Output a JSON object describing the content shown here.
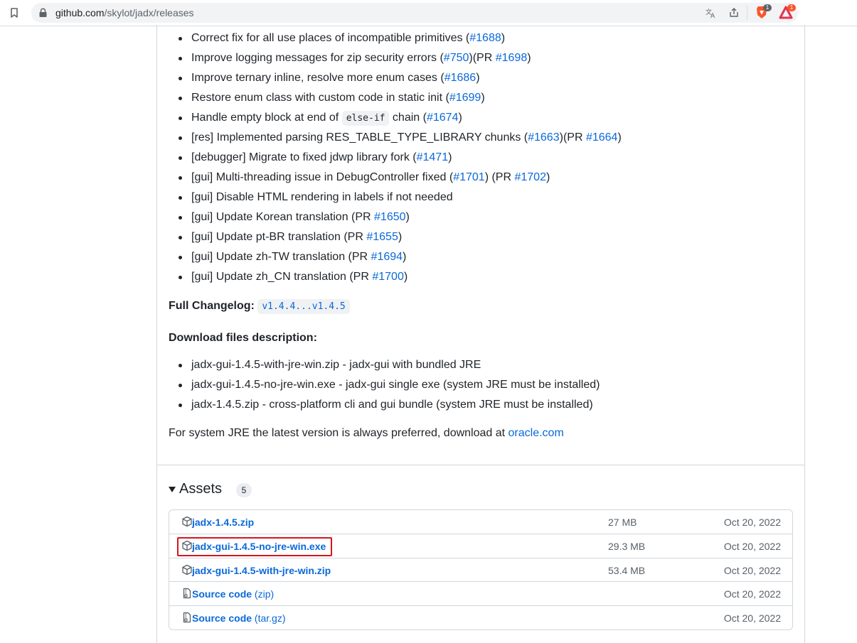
{
  "browser": {
    "url_host": "github.com",
    "url_path": "/skylot/jadx/releases",
    "extensions": [
      {
        "name": "brave-shields",
        "badge": "1",
        "color": "#fb542b"
      },
      {
        "name": "brave-rewards",
        "badge": "1",
        "color": "#fb542b"
      }
    ]
  },
  "notes": [
    {
      "parts": [
        {
          "t": "Correct fix for all use places of incompatible primitives ("
        },
        {
          "l": "#1688"
        },
        {
          "t": ")"
        }
      ]
    },
    {
      "parts": [
        {
          "t": "Improve logging messages for zip security errors ("
        },
        {
          "l": "#750"
        },
        {
          "t": ")(PR "
        },
        {
          "l": "#1698"
        },
        {
          "t": ")"
        }
      ]
    },
    {
      "parts": [
        {
          "t": "Improve ternary inline, resolve more enum cases ("
        },
        {
          "l": "#1686"
        },
        {
          "t": ")"
        }
      ]
    },
    {
      "parts": [
        {
          "t": "Restore enum class with custom code in static init ("
        },
        {
          "l": "#1699"
        },
        {
          "t": ")"
        }
      ]
    },
    {
      "parts": [
        {
          "t": "Handle empty block at end of "
        },
        {
          "c": "else-if"
        },
        {
          "t": " chain ("
        },
        {
          "l": "#1674"
        },
        {
          "t": ")"
        }
      ]
    },
    {
      "parts": [
        {
          "t": "[res] Implemented parsing RES_TABLE_TYPE_LIBRARY chunks ("
        },
        {
          "l": "#1663"
        },
        {
          "t": ")(PR "
        },
        {
          "l": "#1664"
        },
        {
          "t": ")"
        }
      ]
    },
    {
      "parts": [
        {
          "t": "[debugger] Migrate to fixed jdwp library fork ("
        },
        {
          "l": "#1471"
        },
        {
          "t": ")"
        }
      ]
    },
    {
      "parts": [
        {
          "t": "[gui] Multi-threading issue in DebugController fixed ("
        },
        {
          "l": "#1701"
        },
        {
          "t": ") (PR "
        },
        {
          "l": "#1702"
        },
        {
          "t": ")"
        }
      ]
    },
    {
      "parts": [
        {
          "t": "[gui] Disable HTML rendering in labels if not needed"
        }
      ]
    },
    {
      "parts": [
        {
          "t": "[gui] Update Korean translation (PR "
        },
        {
          "l": "#1650"
        },
        {
          "t": ")"
        }
      ]
    },
    {
      "parts": [
        {
          "t": "[gui] Update pt-BR translation (PR "
        },
        {
          "l": "#1655"
        },
        {
          "t": ")"
        }
      ]
    },
    {
      "parts": [
        {
          "t": "[gui] Update zh-TW translation (PR "
        },
        {
          "l": "#1694"
        },
        {
          "t": ")"
        }
      ]
    },
    {
      "parts": [
        {
          "t": "[gui] Update zh_CN translation (PR "
        },
        {
          "l": "#1700"
        },
        {
          "t": ")"
        }
      ]
    }
  ],
  "changelog": {
    "label": "Full Changelog",
    "colon": ":",
    "ref": "v1.4.4...v1.4.5"
  },
  "download_heading": "Download files description:",
  "downloads": [
    "jadx-gui-1.4.5-with-jre-win.zip - jadx-gui with bundled JRE",
    "jadx-gui-1.4.5-no-jre-win.exe - jadx-gui single exe (system JRE must be installed)",
    "jadx-1.4.5.zip - cross-platform cli and gui bundle (system JRE must be installed)"
  ],
  "jre_note": {
    "text": "For system JRE the latest version is always preferred, download at ",
    "link": "oracle.com"
  },
  "assets": {
    "title": "Assets",
    "count": "5",
    "rows": [
      {
        "name": "jadx-1.4.5.zip",
        "suffix": "",
        "size": "27 MB",
        "date": "Oct 20, 2022",
        "icon": "package-icon"
      },
      {
        "name": "jadx-gui-1.4.5-no-jre-win.exe",
        "suffix": "",
        "size": "29.3 MB",
        "date": "Oct 20, 2022",
        "icon": "package-icon"
      },
      {
        "name": "jadx-gui-1.4.5-with-jre-win.zip",
        "suffix": "",
        "size": "53.4 MB",
        "date": "Oct 20, 2022",
        "icon": "package-icon"
      },
      {
        "name": "Source code",
        "suffix": " (zip)",
        "size": "",
        "date": "Oct 20, 2022",
        "icon": "file-zip-icon"
      },
      {
        "name": "Source code",
        "suffix": " (tar.gz)",
        "size": "",
        "date": "Oct 20, 2022",
        "icon": "file-zip-icon"
      }
    ]
  }
}
